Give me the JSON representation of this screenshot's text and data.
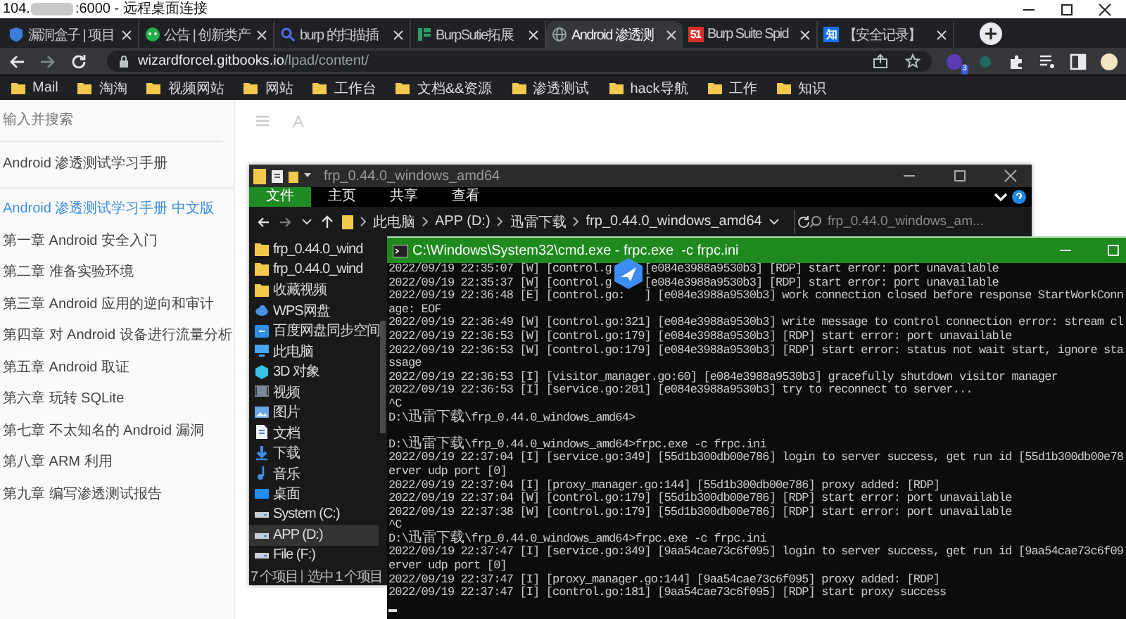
{
  "remote_window": {
    "title_start": "104.",
    "title_end": ":6000 - 远程桌面连接"
  },
  "browser": {
    "tabs": [
      {
        "title": "漏洞盒子 | 项目",
        "selected": false,
        "kind": "shield",
        "color": "#3b7ddd"
      },
      {
        "title": "公告 | 创新类产",
        "selected": false,
        "kind": "chat",
        "color": "#22b14c"
      },
      {
        "title": "burp 的扫描插",
        "selected": false,
        "kind": "search",
        "color": "#4e6ef2"
      },
      {
        "title": "BurpSutie拓展",
        "selected": false,
        "kind": "bars",
        "color": "#2e9e6b"
      },
      {
        "title": "Android 渗透测",
        "selected": true,
        "kind": "globe",
        "color": "#9aa0a6"
      },
      {
        "title": "Burp Suite Spid",
        "selected": false,
        "kind": "badge",
        "badge_text": "51",
        "color": "#d9302c"
      },
      {
        "title": "【安全记录】",
        "selected": false,
        "kind": "badge",
        "badge_text": "知",
        "color": "#1772f6"
      }
    ],
    "url_host": "wizardforcel.gitbooks.io",
    "url_path": "/lpad/content/",
    "extension_badge": "3",
    "bookmarks": [
      "Mail",
      "淘淘",
      "视频网站",
      "网站",
      "工作台",
      "文档&&资源",
      "渗透测试",
      "hack导航",
      "工作",
      "知识"
    ]
  },
  "sidebar": {
    "search": {
      "placeholder": "输入并搜索"
    },
    "items": [
      {
        "label": "Android 渗透测试学习手册",
        "kind": "header",
        "selected": false
      },
      {
        "label": "Android 渗透测试学习手册 中文版",
        "kind": "link",
        "selected": true
      },
      {
        "label": "第一章 Android 安全入门",
        "kind": "link",
        "selected": false
      },
      {
        "label": "第二章 准备实验环境",
        "kind": "link",
        "selected": false
      },
      {
        "label": "第三章 Android 应用的逆向和审计",
        "kind": "link",
        "selected": false
      },
      {
        "label": "第四章 对 Android 设备进行流量分析",
        "kind": "link",
        "selected": false
      },
      {
        "label": "第五章 Android 取证",
        "kind": "link",
        "selected": false
      },
      {
        "label": "第六章 玩转 SQLite",
        "kind": "link",
        "selected": false
      },
      {
        "label": "第七章 不太知名的 Android 漏洞",
        "kind": "link",
        "selected": false
      },
      {
        "label": "第八章 ARM 利用",
        "kind": "link",
        "selected": false
      },
      {
        "label": "第九章 编写渗透测试报告",
        "kind": "link",
        "selected": false
      }
    ]
  },
  "explorer": {
    "title": "frp_0.44.0_windows_amd64",
    "ribbon": [
      {
        "label": "文件",
        "selected": true
      },
      {
        "label": "主页",
        "selected": false
      },
      {
        "label": "共享",
        "selected": false
      },
      {
        "label": "查看",
        "selected": false
      }
    ],
    "breadcrumb": [
      "此电脑",
      "APP (D:)",
      "迅雷下载",
      "frp_0.44.0_windows_amd64"
    ],
    "search": {
      "placeholder": "frp_0.44.0_windows_am..."
    },
    "nav": [
      {
        "label": "frp_0.44.0_wind",
        "kind": "folder",
        "selected": false
      },
      {
        "label": "frp_0.44.0_wind",
        "kind": "folder",
        "selected": false
      },
      {
        "label": "收藏视频",
        "kind": "folder",
        "selected": false
      },
      {
        "label": "WPS网盘",
        "kind": "cloud",
        "selected": false
      },
      {
        "label": "百度网盘同步空间",
        "kind": "sync",
        "selected": false
      },
      {
        "label": "此电脑",
        "kind": "pc",
        "selected": false
      },
      {
        "label": "3D 对象",
        "kind": "cube",
        "selected": false
      },
      {
        "label": "视频",
        "kind": "video",
        "selected": false
      },
      {
        "label": "图片",
        "kind": "picture",
        "selected": false
      },
      {
        "label": "文档",
        "kind": "document",
        "selected": false
      },
      {
        "label": "下载",
        "kind": "download",
        "selected": false
      },
      {
        "label": "音乐",
        "kind": "music",
        "selected": false
      },
      {
        "label": "桌面",
        "kind": "desktop",
        "selected": false
      },
      {
        "label": "System (C:)",
        "kind": "drive",
        "selected": false
      },
      {
        "label": "APP (D:)",
        "kind": "drive",
        "selected": true
      },
      {
        "label": "File (F:)",
        "kind": "drive",
        "selected": false
      }
    ],
    "status": [
      "7 个项目",
      "选中 1 个项目"
    ]
  },
  "console": {
    "title": "C:\\Windows\\System32\\cmd.exe - frpc.exe  -c frpc.ini",
    "lines": [
      {
        "kind": "text",
        "segments": [
          "2022/09/19 22:35:07 [W] [control.g",
          "[e084e3988a9530b3] [RDP] start error: port unavailable"
        ]
      },
      {
        "kind": "text",
        "segments": [
          "2022/09/19 22:35:37 [W] [control.g",
          "[e084e3988a9530b3] [RDP] start error: port unavailable"
        ]
      },
      {
        "kind": "text",
        "segments": [
          "2022/09/19 22:36:48 [E] [control.go:",
          "] [e084e3988a9530b3] work connection closed before response StartWorkConn"
        ]
      },
      {
        "kind": "text",
        "segments": [
          "age: EOF"
        ]
      },
      {
        "kind": "text",
        "segments": [
          "2022/09/19 22:36:49 [W] [control.go:321] [e084e3988a9530b3] write message to control connection error: stream cl"
        ]
      },
      {
        "kind": "text",
        "segments": [
          "2022/09/19 22:36:53 [W] [control.go:179] [e084e3988a9530b3] [RDP] start error: port unavailable"
        ]
      },
      {
        "kind": "text",
        "segments": [
          "2022/09/19 22:36:53 [W] [control.go:179] [e084e3988a9530b3] [RDP] start error: status not wait start, ignore sta"
        ]
      },
      {
        "kind": "text",
        "segments": [
          "ssage"
        ]
      },
      {
        "kind": "text",
        "segments": [
          "2022/09/19 22:36:53 [I] [visitor_manager.go:60] [e084e3988a9530b3] gracefully shutdown visitor manager"
        ]
      },
      {
        "kind": "text",
        "segments": [
          "2022/09/19 22:36:53 [I] [service.go:201] [e084e3988a9530b3] try to reconnect to server..."
        ]
      },
      {
        "kind": "text",
        "segments": [
          "^C"
        ]
      },
      {
        "kind": "text",
        "segments": [
          "D:\\迅雷下载\\frp_0.44.0_windows_amd64>"
        ]
      },
      {
        "kind": "blank"
      },
      {
        "kind": "text",
        "segments": [
          "D:\\迅雷下载\\frp_0.44.0_windows_amd64>frpc.exe -c frpc.ini"
        ]
      },
      {
        "kind": "text",
        "segments": [
          "2022/09/19 22:37:04 [I] [service.go:349] [55d1b300db00e786] login to server success, get run id [55d1b300db00e78"
        ]
      },
      {
        "kind": "text",
        "segments": [
          "erver udp port [0]"
        ]
      },
      {
        "kind": "text",
        "segments": [
          "2022/09/19 22:37:04 [I] [proxy_manager.go:144] [55d1b300db00e786] proxy added: [RDP]"
        ]
      },
      {
        "kind": "text",
        "segments": [
          "2022/09/19 22:37:04 [W] [control.go:179] [55d1b300db00e786] [RDP] start error: port unavailable"
        ]
      },
      {
        "kind": "text",
        "segments": [
          "2022/09/19 22:37:38 [W] [control.go:179] [55d1b300db00e786] [RDP] start error: port unavailable"
        ]
      },
      {
        "kind": "text",
        "segments": [
          "^C"
        ]
      },
      {
        "kind": "text",
        "segments": [
          "D:\\迅雷下载\\frp_0.44.0_windows_amd64>frpc.exe -c frpc.ini"
        ]
      },
      {
        "kind": "text",
        "segments": [
          "2022/09/19 22:37:47 [I] [service.go:349] [9aa54cae73c6f095] login to server success, get run id [9aa54cae73c6f09"
        ]
      },
      {
        "kind": "text",
        "segments": [
          "erver udp port [0]"
        ]
      },
      {
        "kind": "text",
        "segments": [
          "2022/09/19 22:37:47 [I] [proxy_manager.go:144] [9aa54cae73c6f095] proxy added: [RDP]"
        ]
      },
      {
        "kind": "text",
        "segments": [
          "2022/09/19 22:37:47 [I] [control.go:181] [9aa54cae73c6f095] [RDP] start proxy success"
        ]
      },
      {
        "kind": "cursor"
      }
    ]
  }
}
